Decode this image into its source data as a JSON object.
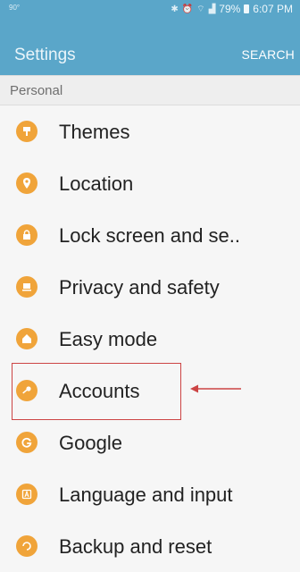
{
  "status_bar": {
    "left_text": "90°",
    "battery_text": "79%",
    "time": "6:07 PM"
  },
  "app_bar": {
    "title": "Settings",
    "action": "SEARCH"
  },
  "section_header": "Personal",
  "items": [
    {
      "label": "Themes",
      "icon": "themes-icon"
    },
    {
      "label": "Location",
      "icon": "location-icon"
    },
    {
      "label": "Lock screen and se..",
      "icon": "lock-icon"
    },
    {
      "label": "Privacy and safety",
      "icon": "privacy-icon"
    },
    {
      "label": "Easy mode",
      "icon": "easy-mode-icon"
    },
    {
      "label": "Accounts",
      "icon": "key-icon"
    },
    {
      "label": "Google",
      "icon": "google-icon"
    },
    {
      "label": "Language and input",
      "icon": "language-icon"
    },
    {
      "label": "Backup and reset",
      "icon": "backup-icon"
    }
  ],
  "colors": {
    "accent": "#5aa6c9",
    "icon_orange": "#f0a43a",
    "annotation_red": "#cc4444"
  }
}
